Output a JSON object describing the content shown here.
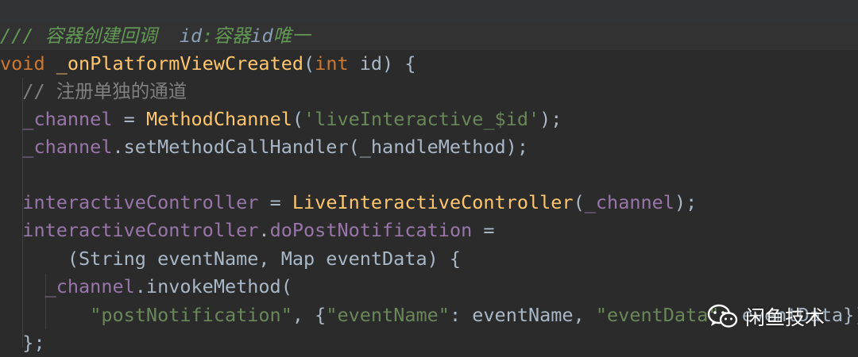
{
  "editor": {
    "lines": [
      {
        "tokens": [
          {
            "t": "/// 容器创建回调  ",
            "c": "c-doc"
          },
          {
            "t": "id",
            "c": "c-docid"
          },
          {
            "t": ":容器",
            "c": "c-doc"
          },
          {
            "t": "id",
            "c": "c-docid"
          },
          {
            "t": "唯一",
            "c": "c-doc"
          }
        ]
      },
      {
        "tokens": [
          {
            "t": "void ",
            "c": "kw"
          },
          {
            "t": "_onPlatformViewCreated",
            "c": "fn"
          },
          {
            "t": "(",
            "c": "pl"
          },
          {
            "t": "int ",
            "c": "kw"
          },
          {
            "t": "id) {",
            "c": "pl"
          }
        ]
      },
      {
        "tokens": [
          {
            "t": "  // 注册单独的通道",
            "c": "c-com"
          }
        ]
      },
      {
        "tokens": [
          {
            "t": "  _channel",
            "c": "fld"
          },
          {
            "t": " = ",
            "c": "pl"
          },
          {
            "t": "MethodChannel",
            "c": "fn"
          },
          {
            "t": "(",
            "c": "pl"
          },
          {
            "t": "'liveInteractive_$id'",
            "c": "str"
          },
          {
            "t": ");",
            "c": "pl"
          }
        ]
      },
      {
        "tokens": [
          {
            "t": "  _channel",
            "c": "fld"
          },
          {
            "t": ".setMethodCallHandler(_handleMethod);",
            "c": "pl"
          }
        ]
      },
      {
        "tokens": []
      },
      {
        "tokens": [
          {
            "t": "  interactiveController",
            "c": "fld"
          },
          {
            "t": " = ",
            "c": "pl"
          },
          {
            "t": "LiveInteractiveController",
            "c": "fn"
          },
          {
            "t": "(",
            "c": "pl"
          },
          {
            "t": "_channel",
            "c": "fld"
          },
          {
            "t": ");",
            "c": "pl"
          }
        ]
      },
      {
        "tokens": [
          {
            "t": "  interactiveController",
            "c": "fld"
          },
          {
            "t": ".",
            "c": "pl"
          },
          {
            "t": "doPostNotification",
            "c": "fld"
          },
          {
            "t": " =",
            "c": "pl"
          }
        ]
      },
      {
        "tokens": [
          {
            "t": "      (String eventName, Map eventData) {",
            "c": "pl"
          }
        ]
      },
      {
        "tokens": [
          {
            "t": "    _channel",
            "c": "fld"
          },
          {
            "t": ".invokeMethod(",
            "c": "pl"
          }
        ]
      },
      {
        "tokens": [
          {
            "t": "        ",
            "c": "pl"
          },
          {
            "t": "\"postNotification\"",
            "c": "str"
          },
          {
            "t": ", {",
            "c": "pl"
          },
          {
            "t": "\"eventName\"",
            "c": "str"
          },
          {
            "t": ": eventName, ",
            "c": "pl"
          },
          {
            "t": "\"eventData\"",
            "c": "str"
          },
          {
            "t": ": eventData});",
            "c": "pl"
          }
        ]
      },
      {
        "tokens": [
          {
            "t": "  };",
            "c": "pl"
          }
        ]
      }
    ]
  },
  "watermark": {
    "text": "闲鱼技术",
    "icon": "wechat-icon"
  }
}
